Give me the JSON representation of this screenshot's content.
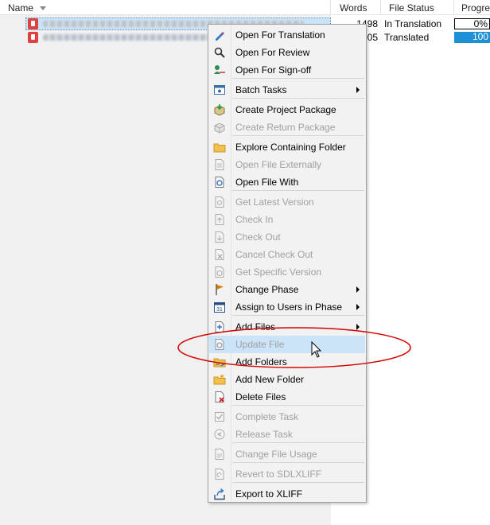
{
  "header": {
    "columns": [
      {
        "label": "Name"
      },
      {
        "label": "Words"
      },
      {
        "label": "File Status"
      },
      {
        "label": "Progre"
      }
    ]
  },
  "rows": [
    {
      "words": "1498",
      "status": "In Translation",
      "progress": "0%",
      "selected": true
    },
    {
      "words": "05",
      "status": "Translated",
      "progress": "100",
      "selected": false
    }
  ],
  "menu": {
    "items": [
      {
        "label": "Open For Translation",
        "icon": "pencil-icon",
        "disabled": false
      },
      {
        "label": "Open For Review",
        "icon": "magnifier-icon",
        "disabled": false
      },
      {
        "label": "Open For Sign-off",
        "icon": "signoff-icon",
        "disabled": false
      },
      {
        "label": "Batch Tasks",
        "icon": "batch-tasks-icon",
        "disabled": false,
        "submenu": true
      },
      {
        "label": "Create Project Package",
        "icon": "package-icon",
        "disabled": false
      },
      {
        "label": "Create Return Package",
        "icon": "return-package-icon",
        "disabled": true
      },
      {
        "label": "Explore Containing Folder",
        "icon": "folder-icon",
        "disabled": false
      },
      {
        "label": "Open File Externally",
        "icon": "document-icon",
        "disabled": true
      },
      {
        "label": "Open File With",
        "icon": "open-with-icon",
        "disabled": false
      },
      {
        "label": "Get Latest Version",
        "icon": "latest-version-icon",
        "disabled": true
      },
      {
        "label": "Check In",
        "icon": "check-in-icon",
        "disabled": true
      },
      {
        "label": "Check Out",
        "icon": "check-out-icon",
        "disabled": true
      },
      {
        "label": "Cancel Check Out",
        "icon": "cancel-check-out-icon",
        "disabled": true
      },
      {
        "label": "Get Specific Version",
        "icon": "specific-version-icon",
        "disabled": true
      },
      {
        "label": "Change Phase",
        "icon": "flag-icon",
        "disabled": false,
        "submenu": true
      },
      {
        "label": "Assign to Users in Phase",
        "icon": "calendar-icon",
        "disabled": false,
        "submenu": true
      },
      {
        "label": "Add Files",
        "icon": "add-files-icon",
        "disabled": false,
        "submenu": true
      },
      {
        "label": "Update File",
        "icon": "update-file-icon",
        "disabled": true,
        "hover": true
      },
      {
        "label": "Add Folders",
        "icon": "add-folders-icon",
        "disabled": false
      },
      {
        "label": "Add New Folder",
        "icon": "new-folder-icon",
        "disabled": false
      },
      {
        "label": "Delete Files",
        "icon": "delete-files-icon",
        "disabled": false
      },
      {
        "label": "Complete Task",
        "icon": "complete-task-icon",
        "disabled": true
      },
      {
        "label": "Release Task",
        "icon": "release-task-icon",
        "disabled": true
      },
      {
        "label": "Change File Usage",
        "icon": "file-usage-icon",
        "disabled": true
      },
      {
        "label": "Revert to SDLXLIFF",
        "icon": "revert-icon",
        "disabled": true
      },
      {
        "label": "Export to XLIFF",
        "icon": "export-icon",
        "disabled": false
      }
    ]
  },
  "colors": {
    "highlight": "#cce4f7",
    "progress_full": "#1e90d6",
    "annotation": "#d40000"
  }
}
